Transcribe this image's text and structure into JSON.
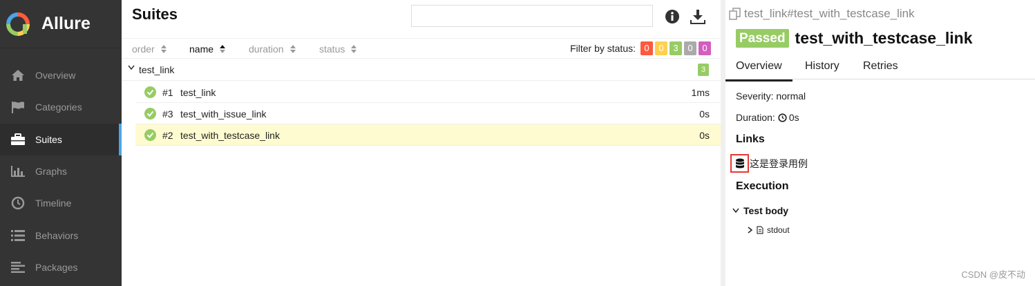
{
  "brand": {
    "name": "Allure"
  },
  "sidebar": {
    "items": [
      {
        "label": "Overview",
        "icon": "home-icon",
        "active": false
      },
      {
        "label": "Categories",
        "icon": "flag-icon",
        "active": false
      },
      {
        "label": "Suites",
        "icon": "briefcase-icon",
        "active": true
      },
      {
        "label": "Graphs",
        "icon": "bar-chart-icon",
        "active": false
      },
      {
        "label": "Timeline",
        "icon": "clock-icon",
        "active": false
      },
      {
        "label": "Behaviors",
        "icon": "list-icon",
        "active": false
      },
      {
        "label": "Packages",
        "icon": "align-left-icon",
        "active": false
      }
    ]
  },
  "suites": {
    "title": "Suites",
    "search": {
      "value": "",
      "placeholder": ""
    },
    "sort": {
      "order": "order",
      "name": "name",
      "duration": "duration",
      "status": "status",
      "active": "name"
    },
    "filter": {
      "label": "Filter by status:",
      "counts": [
        {
          "status": "failed",
          "value": "0",
          "color": "#fd5a3e"
        },
        {
          "status": "broken",
          "value": "0",
          "color": "#ffd050"
        },
        {
          "status": "passed",
          "value": "3",
          "color": "#97cc64"
        },
        {
          "status": "skipped",
          "value": "0",
          "color": "#aaaaaa"
        },
        {
          "status": "unknown",
          "value": "0",
          "color": "#d35ebe"
        }
      ]
    },
    "group": {
      "name": "test_link",
      "count": "3"
    },
    "rows": [
      {
        "num": "#1",
        "name": "test_link",
        "duration": "1ms",
        "selected": false
      },
      {
        "num": "#3",
        "name": "test_with_issue_link",
        "duration": "0s",
        "selected": false
      },
      {
        "num": "#2",
        "name": "test_with_testcase_link",
        "duration": "0s",
        "selected": true
      }
    ]
  },
  "testcase": {
    "breadcrumb": "test_link#test_with_testcase_link",
    "status": "Passed",
    "title": "test_with_testcase_link",
    "tabs": [
      "Overview",
      "History",
      "Retries"
    ],
    "severity": "Severity: normal",
    "duration_label": "Duration:",
    "duration_value": "0s",
    "links_title": "Links",
    "link_text": "这是登录用例",
    "execution_title": "Execution",
    "test_body": "Test body",
    "attachment": "stdout"
  },
  "watermark": "CSDN @皮不动",
  "colors": {
    "sidebar": "#343434",
    "accent": "#4ba4e5",
    "passed": "#97cc64",
    "selected_row": "#fffbd0",
    "highlight": "#e53935"
  }
}
